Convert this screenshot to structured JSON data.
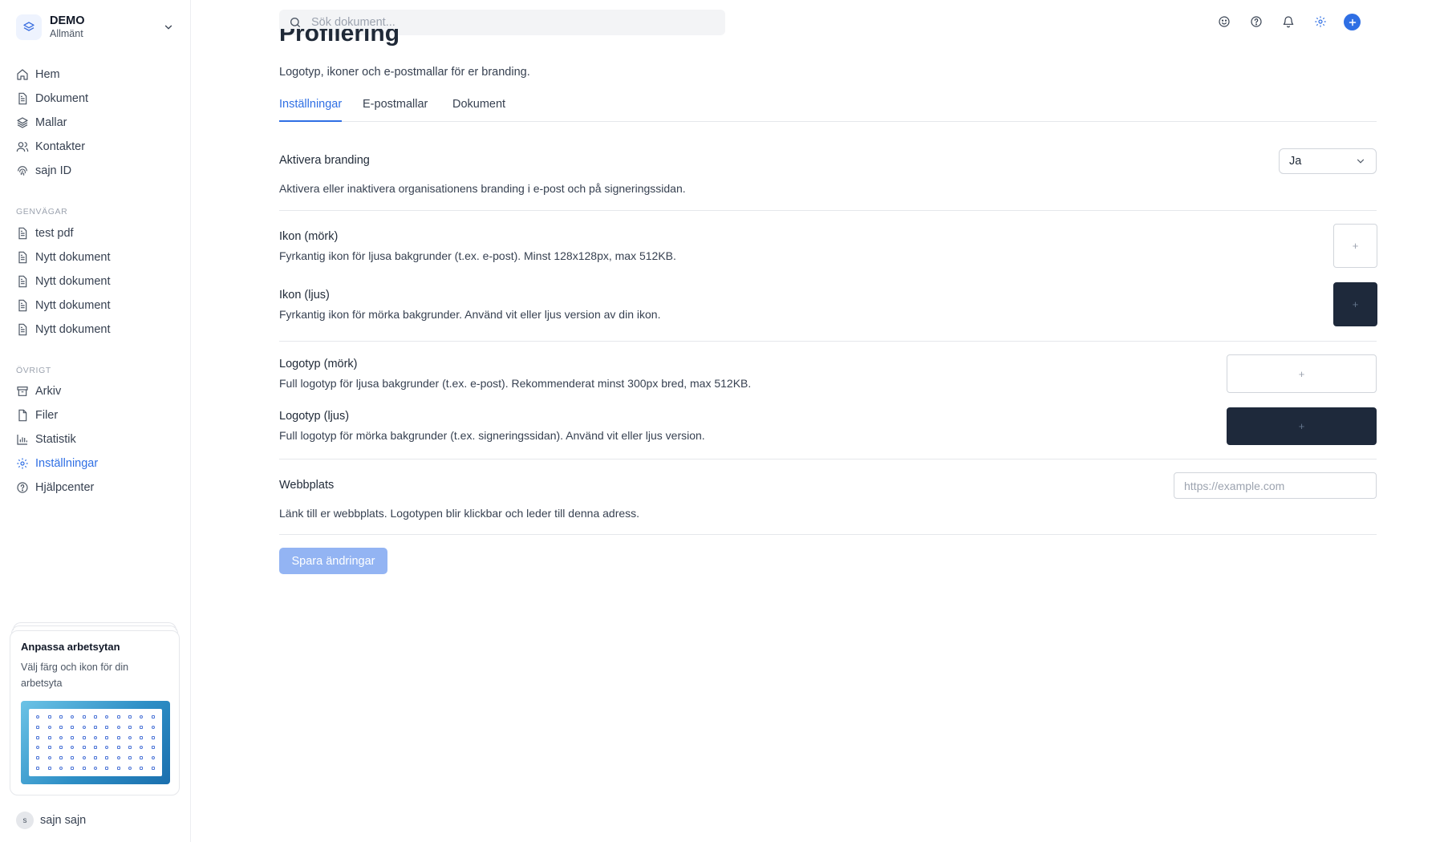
{
  "workspace": {
    "name": "DEMO",
    "subtitle": "Allmänt"
  },
  "nav": {
    "main": [
      {
        "label": "Hem",
        "icon": "home-icon"
      },
      {
        "label": "Dokument",
        "icon": "document-icon"
      },
      {
        "label": "Mallar",
        "icon": "layers-icon"
      },
      {
        "label": "Kontakter",
        "icon": "users-icon"
      },
      {
        "label": "sajn ID",
        "icon": "fingerprint-icon"
      }
    ],
    "shortcuts_label": "GENVÄGAR",
    "shortcuts": [
      {
        "label": "test pdf"
      },
      {
        "label": "Nytt dokument"
      },
      {
        "label": "Nytt dokument"
      },
      {
        "label": "Nytt dokument"
      },
      {
        "label": "Nytt dokument"
      }
    ],
    "other_label": "ÖVRIGT",
    "other": [
      {
        "label": "Arkiv",
        "icon": "archive-icon"
      },
      {
        "label": "Filer",
        "icon": "file-icon"
      },
      {
        "label": "Statistik",
        "icon": "bar-chart-icon"
      },
      {
        "label": "Inställningar",
        "icon": "gear-icon",
        "active": true
      },
      {
        "label": "Hjälpcenter",
        "icon": "help-icon"
      }
    ]
  },
  "promo": {
    "title": "Anpassa arbetsytan",
    "description": "Välj färg och ikon för din arbetsyta"
  },
  "user": {
    "initial": "s",
    "name": "sajn sajn"
  },
  "search": {
    "placeholder": "Sök dokument..."
  },
  "page": {
    "title": "Profilering",
    "subtitle": "Logotyp, ikoner och e-postmallar för er branding.",
    "tabs": [
      {
        "label": "Inställningar",
        "active": true
      },
      {
        "label": "E-postmallar"
      },
      {
        "label": "Dokument"
      }
    ]
  },
  "settings": {
    "branding": {
      "title": "Aktivera branding",
      "description": "Aktivera eller inaktivera organisationens branding i e-post och på signeringssidan.",
      "value": "Ja"
    },
    "icon_dark": {
      "title": "Ikon (mörk)",
      "description": "Fyrkantig ikon för ljusa bakgrunder (t.ex. e-post). Minst 128x128px, max 512KB."
    },
    "icon_light": {
      "title": "Ikon (ljus)",
      "description": "Fyrkantig ikon för mörka bakgrunder. Använd vit eller ljus version av din ikon."
    },
    "logo_dark": {
      "title": "Logotyp (mörk)",
      "description": "Full logotyp för ljusa bakgrunder (t.ex. e-post). Rekommenderat minst 300px bred, max 512KB."
    },
    "logo_light": {
      "title": "Logotyp (ljus)",
      "description": "Full logotyp för mörka bakgrunder (t.ex. signeringssidan). Använd vit eller ljus version."
    },
    "website": {
      "title": "Webbplats",
      "description": "Länk till er webbplats. Logotypen blir klickbar och leder till denna adress.",
      "placeholder": "https://example.com"
    },
    "upload_symbol": "+",
    "save_label": "Spara ändringar"
  },
  "colors": {
    "accent": "#2f6fe4",
    "dark_tile": "#1e293b",
    "save_disabled": "#93b4f3"
  }
}
